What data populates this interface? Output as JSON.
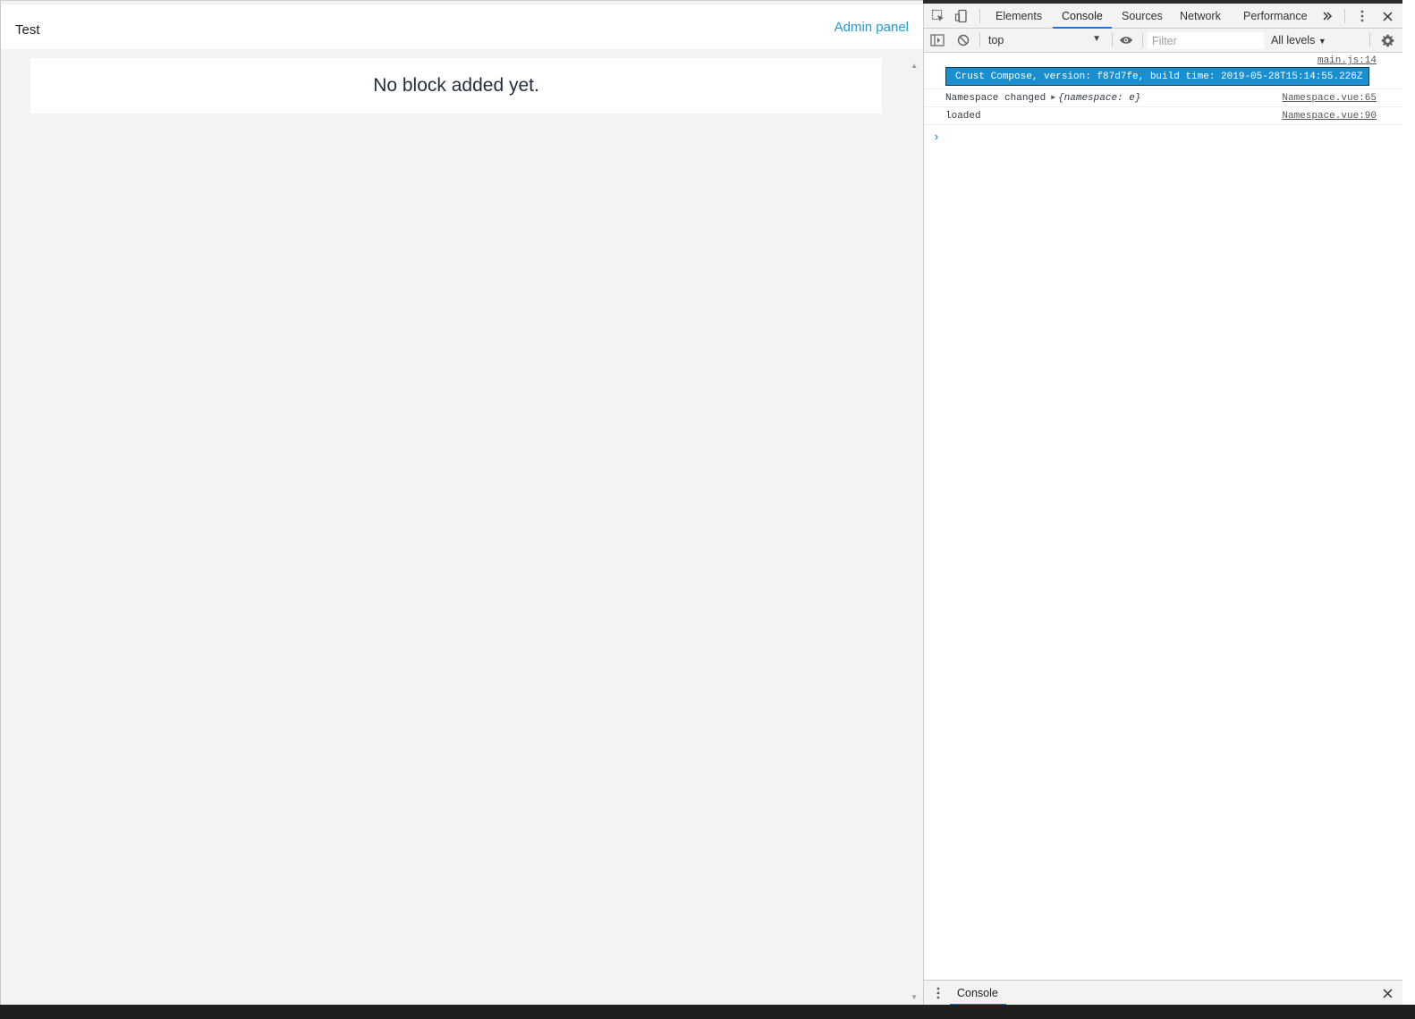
{
  "app": {
    "title": "Test",
    "admin_link": "Admin panel",
    "empty_message": "No block added yet."
  },
  "devtools": {
    "tabs": [
      {
        "label": "Elements",
        "active": false
      },
      {
        "label": "Console",
        "active": true
      },
      {
        "label": "Sources",
        "active": false
      },
      {
        "label": "Network",
        "active": false
      },
      {
        "label": "Performance",
        "active": false
      }
    ],
    "more_tabs_icon": "chevron-double-right-icon",
    "toolbar": {
      "context": "top",
      "filter_placeholder": "Filter",
      "levels": "All levels"
    },
    "messages": [
      {
        "source": "main.js:14",
        "text": "Crust Compose, version: f87d7fe, build time: 2019-05-28T15:14:55.226Z"
      },
      {
        "source": "Namespace.vue:65",
        "text": "Namespace changed",
        "object": "{namespace: e}"
      },
      {
        "source": "Namespace.vue:90",
        "text": "loaded"
      }
    ],
    "prompt": "›",
    "drawer_tab": "Console"
  },
  "colors": {
    "accent": "#1a73e8",
    "link": "#1e9bd6",
    "banner_bg": "#1b8fce"
  }
}
